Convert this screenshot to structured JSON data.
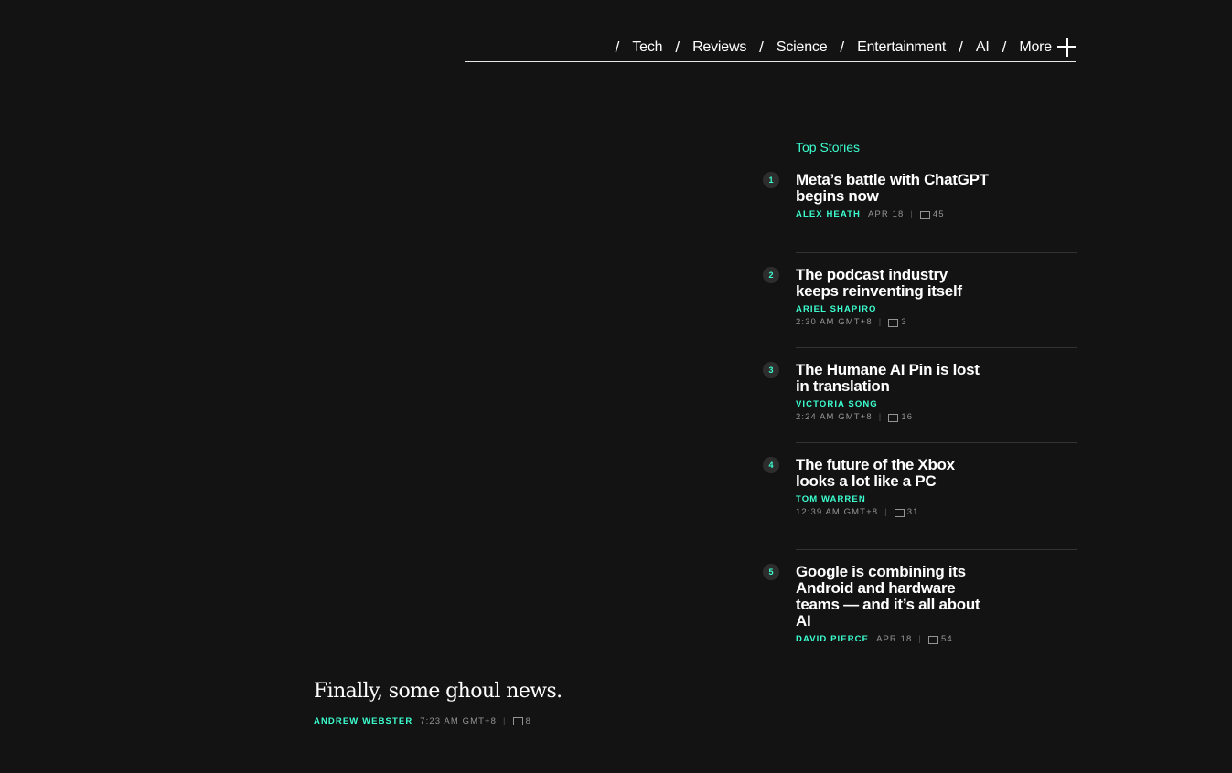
{
  "nav": {
    "items": [
      "Tech",
      "Reviews",
      "Science",
      "Entertainment",
      "AI",
      "More"
    ],
    "separator": "/"
  },
  "top_stories": {
    "title": "Top Stories",
    "items": [
      {
        "rank": "1",
        "title": "Meta’s battle with ChatGPT begins now",
        "author": "ALEX HEATH",
        "time": "APR 18",
        "comments": "45"
      },
      {
        "rank": "2",
        "title": "The podcast industry keeps reinventing itself",
        "author": "ARIEL SHAPIRO",
        "time": "2:30 AM GMT+8",
        "comments": "3"
      },
      {
        "rank": "3",
        "title": "The Humane AI Pin is lost in translation",
        "author": "VICTORIA SONG",
        "time": "2:24 AM GMT+8",
        "comments": "16"
      },
      {
        "rank": "4",
        "title": "The future of the Xbox looks a lot like a PC",
        "author": "TOM WARREN",
        "time": "12:39 AM GMT+8",
        "comments": "31"
      },
      {
        "rank": "5",
        "title": "Google is combining its Android and hardware teams — and it’s all about AI",
        "author": "DAVID PIERCE",
        "time": "APR 18",
        "comments": "54"
      }
    ]
  },
  "feature": {
    "title": "Finally, some ghoul news.",
    "author": "ANDREW WEBSTER",
    "time": "7:23 AM GMT+8",
    "comments": "8"
  },
  "colors": {
    "accent": "#3cffd0",
    "background": "#131313"
  }
}
